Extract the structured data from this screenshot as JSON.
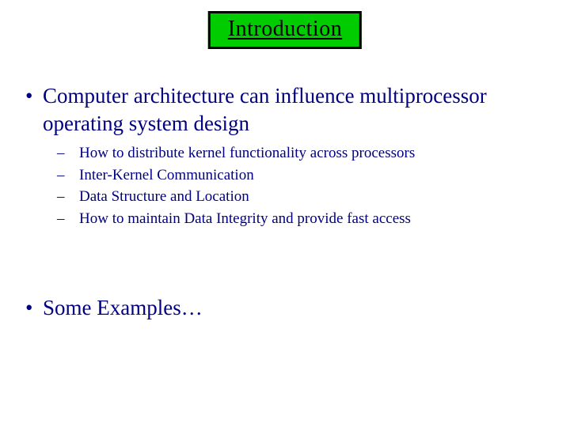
{
  "title": "Introduction",
  "main_bullet": "Computer architecture can influence multiprocessor operating system design",
  "sub_bullets": [
    "How to distribute kernel functionality across processors",
    "Inter-Kernel Communication",
    "Data Structure and Location",
    "How to maintain Data Integrity and provide fast access"
  ],
  "second_bullet": "Some Examples…",
  "glyphs": {
    "dot": "•",
    "dash": "–"
  }
}
